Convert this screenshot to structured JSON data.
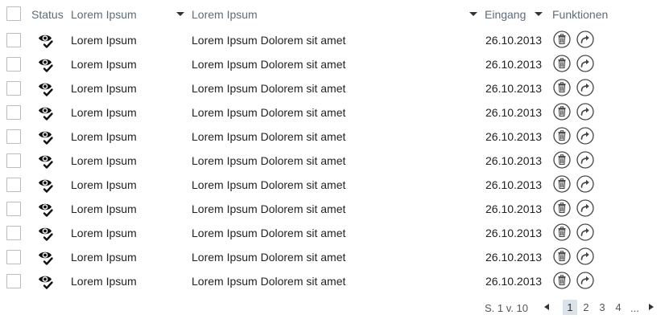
{
  "header": {
    "status": "Status",
    "col1": "Lorem Ipsum",
    "col2": "Lorem Ipsum",
    "eingang": "Eingang",
    "funktionen": "Funktionen"
  },
  "icons": {
    "status": "eye-check-icon",
    "delete": "trash-icon",
    "forward": "forward-arrow-icon",
    "sort": "caret-down-icon"
  },
  "rows": [
    {
      "col1": "Lorem Ipsum",
      "col2": "Lorem Ipsum Dolorem sit amet",
      "date": "26.10.2013"
    },
    {
      "col1": "Lorem Ipsum",
      "col2": "Lorem Ipsum Dolorem sit amet",
      "date": "26.10.2013"
    },
    {
      "col1": "Lorem Ipsum",
      "col2": "Lorem Ipsum Dolorem sit amet",
      "date": "26.10.2013"
    },
    {
      "col1": "Lorem Ipsum",
      "col2": "Lorem Ipsum Dolorem sit amet",
      "date": "26.10.2013"
    },
    {
      "col1": "Lorem Ipsum",
      "col2": "Lorem Ipsum Dolorem sit amet",
      "date": "26.10.2013"
    },
    {
      "col1": "Lorem Ipsum",
      "col2": "Lorem Ipsum Dolorem sit amet",
      "date": "26.10.2013"
    },
    {
      "col1": "Lorem Ipsum",
      "col2": "Lorem Ipsum Dolorem sit amet",
      "date": "26.10.2013"
    },
    {
      "col1": "Lorem Ipsum",
      "col2": "Lorem Ipsum Dolorem sit amet",
      "date": "26.10.2013"
    },
    {
      "col1": "Lorem Ipsum",
      "col2": "Lorem Ipsum Dolorem sit amet",
      "date": "26.10.2013"
    },
    {
      "col1": "Lorem Ipsum",
      "col2": "Lorem Ipsum Dolorem sit amet",
      "date": "26.10.2013"
    },
    {
      "col1": "Lorem Ipsum",
      "col2": "Lorem Ipsum Dolorem sit amet",
      "date": "26.10.2013"
    }
  ],
  "pagination": {
    "info": "S. 1 v. 10",
    "pages": [
      "1",
      "2",
      "3",
      "4"
    ],
    "active_page": "1",
    "ellipsis": "..."
  },
  "colors": {
    "header_text": "#5d6c7a",
    "active_page_bg": "#dbe3ea",
    "icon_stroke": "#444444"
  }
}
